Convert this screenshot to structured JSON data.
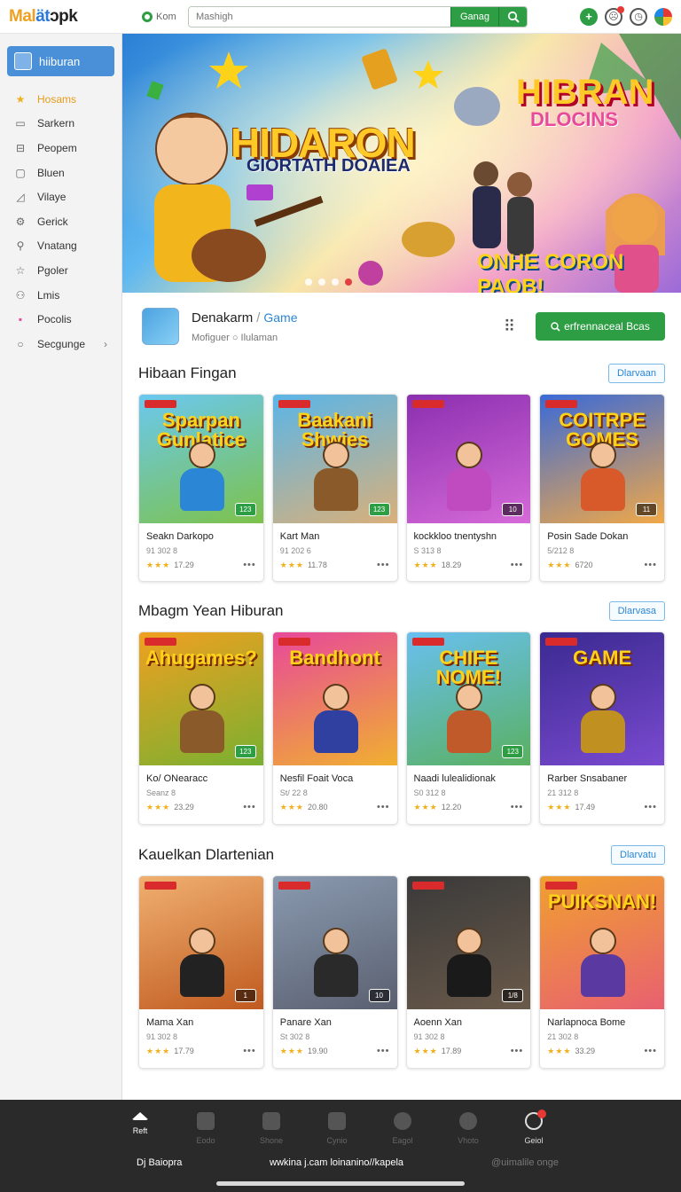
{
  "header": {
    "logo_a": "Mal",
    "logo_b": "ät",
    "logo_c": "ɔpk",
    "online_label": "Kom",
    "search_placeholder": "Mashigh",
    "search_button": "Ganag"
  },
  "sidebar": {
    "active_label": "hiiburan",
    "items": [
      {
        "label": "Hosams",
        "icon": "star-icon",
        "glyph": "★",
        "highlight": true
      },
      {
        "label": "Sarkern",
        "icon": "rectangle-icon",
        "glyph": "▭"
      },
      {
        "label": "Peopem",
        "icon": "grid-icon",
        "glyph": "⊟"
      },
      {
        "label": "Bluen",
        "icon": "square-icon",
        "glyph": "▢"
      },
      {
        "label": "Vilaye",
        "icon": "chart-icon",
        "glyph": "◿"
      },
      {
        "label": "Gerick",
        "icon": "gear-icon",
        "glyph": "⚙"
      },
      {
        "label": "Vnatang",
        "icon": "search-icon",
        "glyph": "⚲"
      },
      {
        "label": "Pgoler",
        "icon": "star-outline-icon",
        "glyph": "☆"
      },
      {
        "label": "Lmis",
        "icon": "people-icon",
        "glyph": "⚇"
      },
      {
        "label": "Pocolis",
        "icon": "pink-square-icon",
        "glyph": "▪"
      },
      {
        "label": "Secgunge",
        "icon": "magnifier-icon",
        "glyph": "○",
        "chevron": "›"
      }
    ]
  },
  "banner": {
    "title": "HIDARON",
    "subtitle": "GIORTATH DOAIEA",
    "right_title": "HIBRAN",
    "right_sub": "DLOCINS",
    "bottom_text": "ONHE CORON PAOB!",
    "slides": 4,
    "active_slide": 4
  },
  "app": {
    "title": "Denakarm",
    "separator": "/",
    "category": "Game",
    "subtitle": "Mofiguer ○ Ilulaman",
    "download_label": "erfrennaceal Bcas"
  },
  "sections": [
    {
      "title": "Hibaan Fingan",
      "link": "Dlarvaan",
      "cards": [
        {
          "thumb_title": "Sparpan Gunlatice",
          "name": "Seakn Darkopo",
          "meta": "91 302 8",
          "rating": "17.29",
          "count": "123",
          "colors": [
            "#6ac8f0",
            "#7dc24a"
          ],
          "fig": "#2b86d6"
        },
        {
          "thumb_title": "Baakani Shwies",
          "name": "Kart Man",
          "meta": "91 202 6",
          "rating": "11.78",
          "count": "123",
          "colors": [
            "#5ab5e8",
            "#d9b07a"
          ],
          "fig": "#8a5a2a"
        },
        {
          "thumb_title": "",
          "name": "kockkloo tnentyshn",
          "meta": "S 313 8",
          "rating": "18.29",
          "count": "10",
          "colors": [
            "#8b2fb0",
            "#d66ad8"
          ],
          "fig": "#c04ac0"
        },
        {
          "thumb_title": "COITRPE GOMES",
          "name": "Posin Sade Dokan",
          "meta": "5/212 8",
          "rating": "6720",
          "count": "11",
          "colors": [
            "#3a6ad8",
            "#f0a848"
          ],
          "fig": "#d85a2a"
        }
      ]
    },
    {
      "title": "Mbagm Yean Hiburan",
      "link": "Dlarvasa",
      "cards": [
        {
          "thumb_title": "Ahugames?",
          "name": "Ko/ ONearacc",
          "meta": "Seanz 8",
          "rating": "23.29",
          "count": "123",
          "colors": [
            "#f0a020",
            "#7ab030"
          ],
          "fig": "#8a5a2a"
        },
        {
          "thumb_title": "Bandhont",
          "name": "Nesfil Foait Voca",
          "meta": "St/ 22 8",
          "rating": "20.80",
          "count": "",
          "colors": [
            "#e8489a",
            "#f0b030"
          ],
          "fig": "#3040a0"
        },
        {
          "thumb_title": "CHIFE NOME!",
          "name": "Naadi lulealidionak",
          "meta": "S0 312 8",
          "rating": "12.20",
          "count": "123",
          "colors": [
            "#68c0f0",
            "#5ab060"
          ],
          "fig": "#c05a2a"
        },
        {
          "thumb_title": "GAME",
          "name": "Rarber Snsabaner",
          "meta": "21 312 8",
          "rating": "17.49",
          "count": "",
          "colors": [
            "#3a2a90",
            "#7a4ad0"
          ],
          "fig": "#c09020"
        }
      ]
    },
    {
      "title": "Kauelkan Dlartenian",
      "link": "Dlarvatu",
      "cards": [
        {
          "thumb_title": "",
          "name": "Mama Xan",
          "meta": "91 302 8",
          "rating": "17.79",
          "count": "1",
          "colors": [
            "#f0b070",
            "#c05a20"
          ],
          "fig": "#222222"
        },
        {
          "thumb_title": "",
          "name": "Panare Xan",
          "meta": "St 302 8",
          "rating": "19.90",
          "count": "10",
          "colors": [
            "#8a9ab0",
            "#5a6070"
          ],
          "fig": "#2a2a2a"
        },
        {
          "thumb_title": "",
          "name": "Aoenn Xan",
          "meta": "91 302 8",
          "rating": "17.89",
          "count": "1/8",
          "colors": [
            "#3a3a3a",
            "#6a5a4a"
          ],
          "fig": "#1a1a1a"
        },
        {
          "thumb_title": "PUIKSNAN!",
          "name": "Narlapnoca Bome",
          "meta": "21 302 8",
          "rating": "33.29",
          "count": "",
          "colors": [
            "#f0a030",
            "#e86070"
          ],
          "fig": "#5a3aa0"
        }
      ]
    }
  ],
  "bottom_nav": {
    "items": [
      {
        "label": "Reft",
        "icon": "home-icon"
      },
      {
        "label": "Eodo",
        "icon": "image-icon"
      },
      {
        "label": "Shone",
        "icon": "store-icon"
      },
      {
        "label": "Cynio",
        "icon": "bag-icon"
      },
      {
        "label": "Eagol",
        "icon": "chevron-circle-icon"
      },
      {
        "label": "Vhoto",
        "icon": "target-icon"
      },
      {
        "label": "Geiol",
        "icon": "people-notification-icon"
      }
    ],
    "footer_left": "Dj Baiopra",
    "footer_mid": "wwkina j.cam loinanino//kapela",
    "footer_right": "@uimalile onge"
  }
}
